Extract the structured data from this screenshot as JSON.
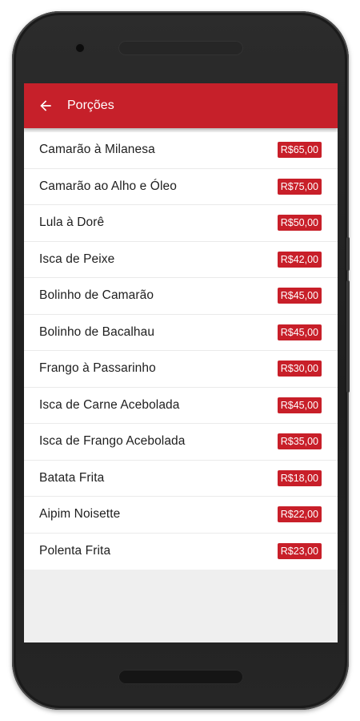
{
  "appbar": {
    "title": "Porções",
    "back_icon": "arrow-left-icon",
    "color": "#c6202a"
  },
  "items": [
    {
      "name": "Camarão à Milanesa",
      "price": "R$65,00"
    },
    {
      "name": "Camarão ao Alho e Óleo",
      "price": "R$75,00"
    },
    {
      "name": "Lula à Dorê",
      "price": "R$50,00"
    },
    {
      "name": "Isca de Peixe",
      "price": "R$42,00"
    },
    {
      "name": "Bolinho de Camarão",
      "price": "R$45,00"
    },
    {
      "name": "Bolinho de Bacalhau",
      "price": "R$45,00"
    },
    {
      "name": "Frango à Passarinho",
      "price": "R$30,00"
    },
    {
      "name": "Isca de Carne Acebolada",
      "price": "R$45,00"
    },
    {
      "name": "Isca de Frango Acebolada",
      "price": "R$35,00"
    },
    {
      "name": "Batata Frita",
      "price": "R$18,00"
    },
    {
      "name": "Aipim Noisette",
      "price": "R$22,00"
    },
    {
      "name": "Polenta Frita",
      "price": "R$23,00"
    }
  ],
  "price_badge_color": "#c81f29"
}
